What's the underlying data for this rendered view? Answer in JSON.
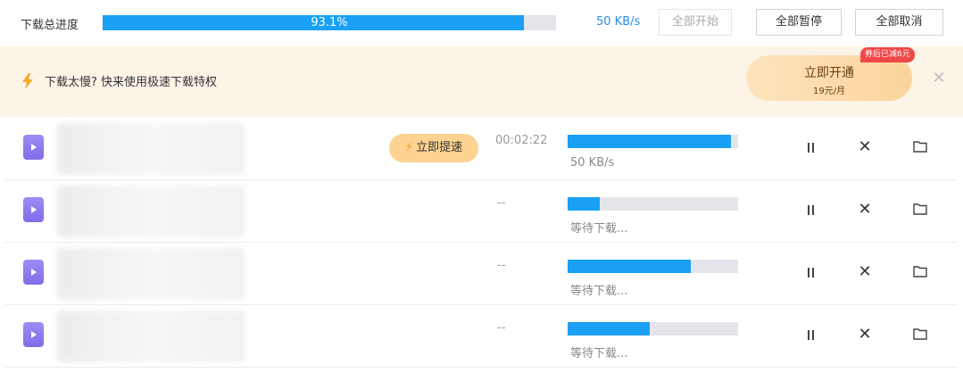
{
  "topbar": {
    "label": "下载总进度",
    "progress_percent": 93.1,
    "progress_text": "93.1%",
    "speed": "50 KB/s",
    "buttons": {
      "start_all": "全部开始",
      "pause_all": "全部暂停",
      "cancel_all": "全部取消"
    }
  },
  "banner": {
    "text": "下载太慢? 快来使用极速下载特权",
    "cta_title": "立即开通",
    "cta_price": "19元/月",
    "coupon": "券后已减6元"
  },
  "rows": [
    {
      "filename": "",
      "boost_label": "立即提速",
      "elapsed": "00:02:22",
      "progress": 0.96,
      "status": "50 KB/s"
    },
    {
      "filename": "",
      "elapsed": "--",
      "progress": 0.19,
      "status": "等待下载..."
    },
    {
      "filename": "",
      "elapsed": "--",
      "progress": 0.72,
      "status": "等待下载..."
    },
    {
      "filename": "",
      "elapsed": "--",
      "progress": 0.48,
      "status": "等待下载..."
    }
  ],
  "colors": {
    "accent": "#1aa0f5",
    "file_icon": "#8b78ef",
    "banner_bg": "#fdf4e8",
    "coupon": "#f04848"
  },
  "icons": {
    "file": "video-file-icon",
    "pause": "pause-icon",
    "cancel": "close-icon",
    "folder": "folder-icon",
    "boost": "lightning-icon"
  }
}
